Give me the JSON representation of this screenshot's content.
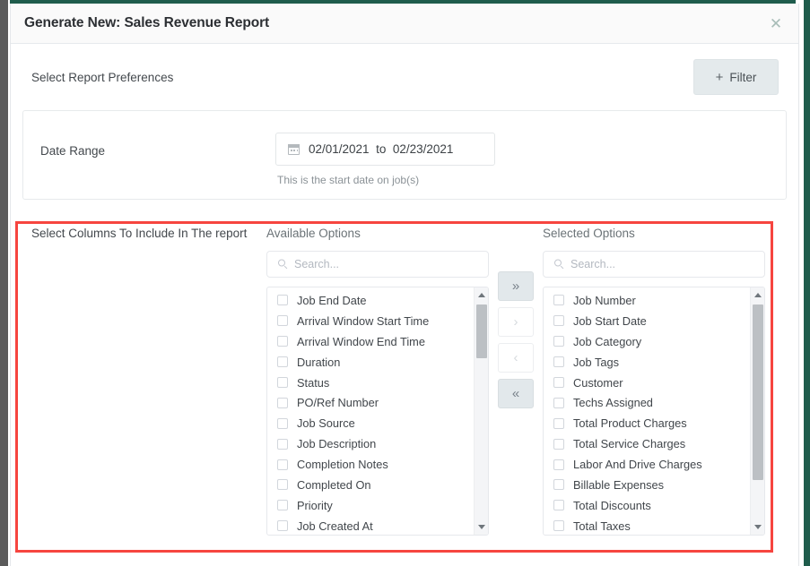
{
  "window": {
    "title": "Generate New: Sales Revenue Report",
    "close_icon": "close-icon",
    "close_glyph": "✕",
    "accent_color": "#1f5c4c"
  },
  "preferences": {
    "label": "Select Report Preferences",
    "filter_button": {
      "label": "Filter",
      "plus_glyph": "+",
      "icon": "plus-icon"
    }
  },
  "date_range": {
    "label": "Date Range",
    "icon": "calendar-icon",
    "value": "02/01/2021  to  02/23/2021",
    "start_date": "02/01/2021",
    "separator": "to",
    "end_date": "02/23/2021",
    "hint": "This is the start date on job(s)"
  },
  "columns": {
    "label": "Select Columns To Include In The report",
    "highlight_color": "#f6453f",
    "available": {
      "heading": "Available Options",
      "search_placeholder": "Search...",
      "search_value": "",
      "search_icon": "search-icon",
      "items": [
        "Job End Date",
        "Arrival Window Start Time",
        "Arrival Window End Time",
        "Duration",
        "Status",
        "PO/Ref Number",
        "Job Source",
        "Job Description",
        "Completion Notes",
        "Completed On",
        "Priority",
        "Job Created At"
      ]
    },
    "selected": {
      "heading": "Selected Options",
      "search_placeholder": "Search...",
      "search_value": "",
      "search_icon": "search-icon",
      "items": [
        "Job Number",
        "Job Start Date",
        "Job Category",
        "Job Tags",
        "Customer",
        "Techs Assigned",
        "Total Product Charges",
        "Total Service Charges",
        "Labor And Drive Charges",
        "Billable Expenses",
        "Total Discounts",
        "Total Taxes"
      ]
    },
    "transfer_buttons": [
      {
        "name": "move-all-right-button",
        "glyph": "»",
        "enabled": true
      },
      {
        "name": "move-right-button",
        "glyph": "›",
        "enabled": false
      },
      {
        "name": "move-left-button",
        "glyph": "‹",
        "enabled": false
      },
      {
        "name": "move-all-left-button",
        "glyph": "«",
        "enabled": true
      }
    ]
  }
}
